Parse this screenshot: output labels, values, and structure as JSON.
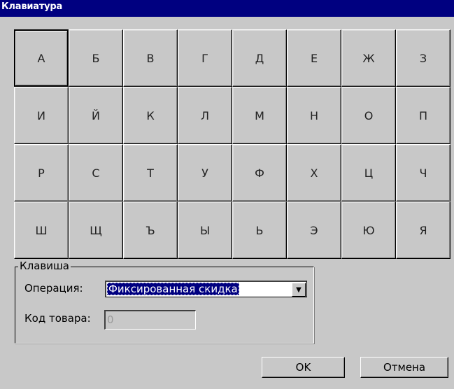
{
  "window": {
    "title": "Клавиатура"
  },
  "keyboard": {
    "selected_index": 0,
    "keys": [
      "А",
      "Б",
      "В",
      "Г",
      "Д",
      "Е",
      "Ж",
      "З",
      "И",
      "Й",
      "К",
      "Л",
      "М",
      "Н",
      "О",
      "П",
      "Р",
      "С",
      "Т",
      "У",
      "Ф",
      "Х",
      "Ц",
      "Ч",
      "Ш",
      "Щ",
      "Ъ",
      "Ы",
      "Ь",
      "Э",
      "Ю",
      "Я"
    ]
  },
  "key_group": {
    "legend": "Клавиша",
    "operation_label": "Операция:",
    "operation_value": "Фиксированная скидка",
    "product_code_label": "Код товара:",
    "product_code_value": "0"
  },
  "buttons": {
    "ok": "OK",
    "cancel": "Отмена"
  },
  "colors": {
    "titlebar": "#000080",
    "window_bg": "#c8c8c8",
    "selection": "#000080"
  }
}
